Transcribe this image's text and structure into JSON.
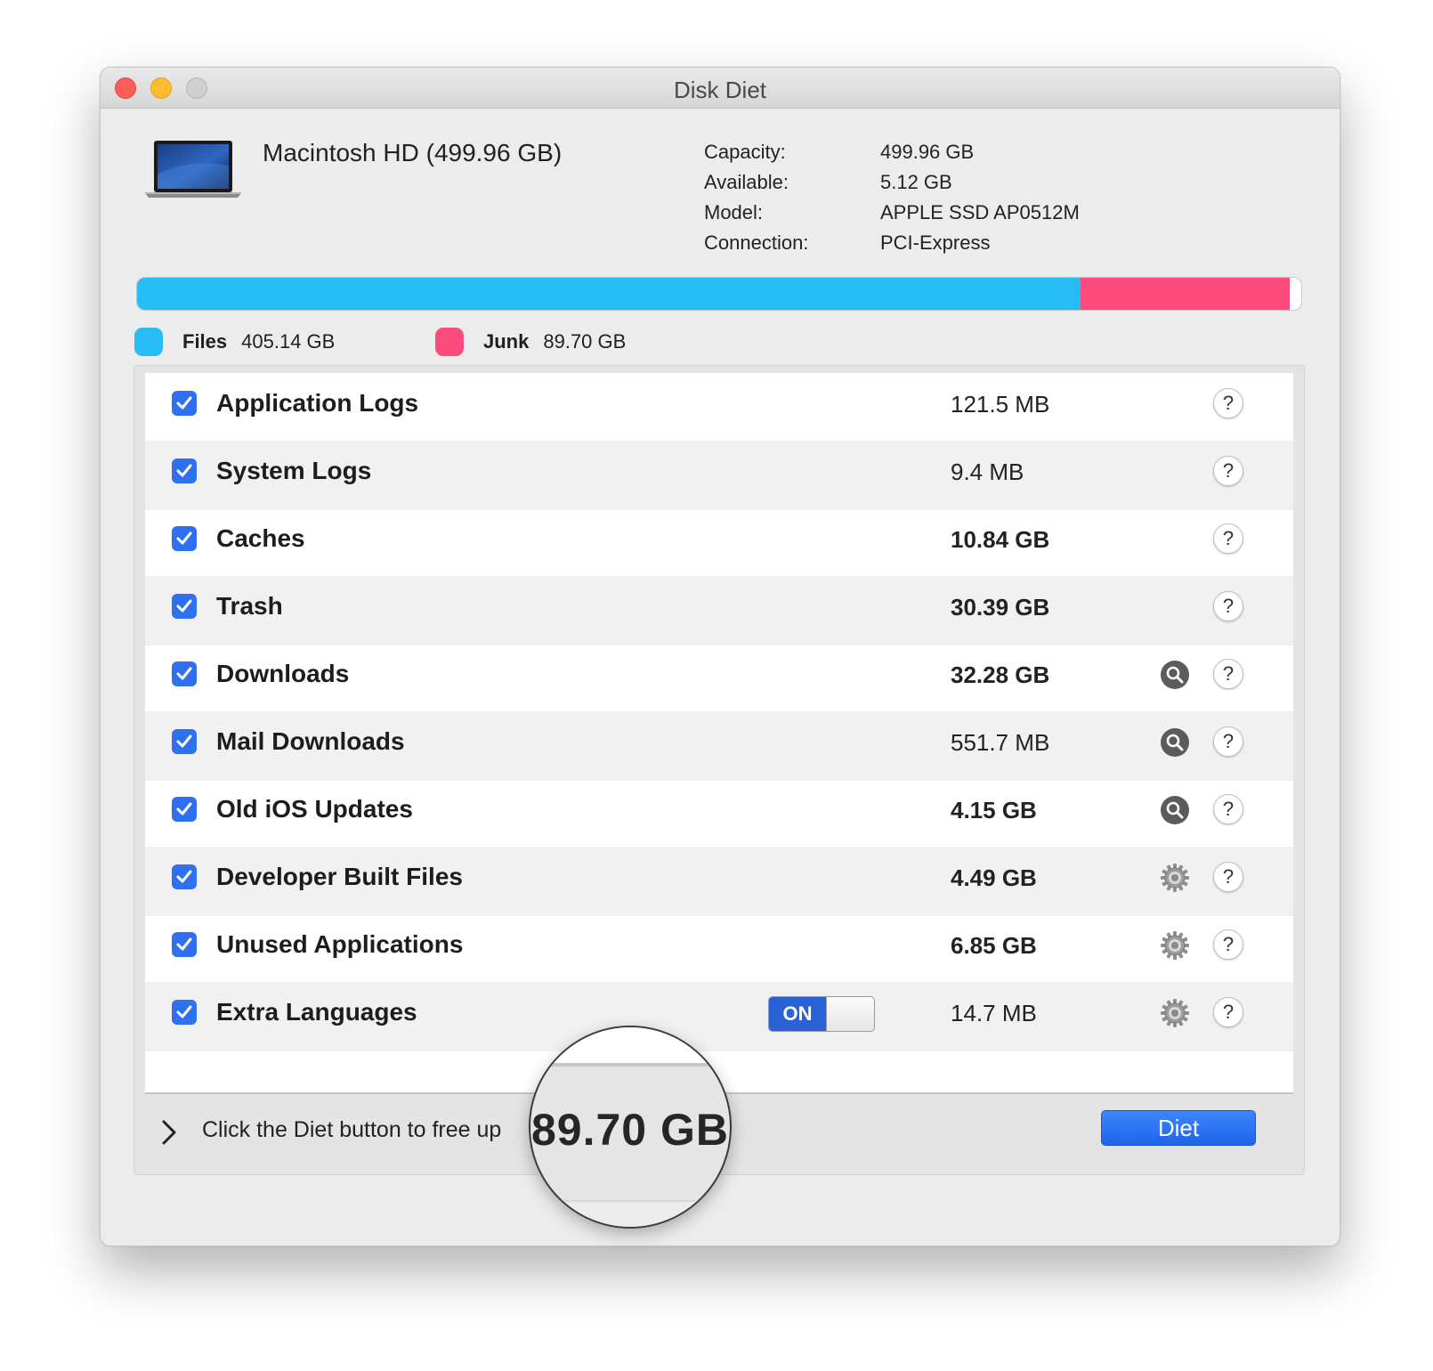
{
  "window": {
    "title": "Disk Diet"
  },
  "disk": {
    "name": "Macintosh HD (499.96 GB)",
    "info": [
      {
        "key": "Capacity:",
        "value": "499.96 GB"
      },
      {
        "key": "Available:",
        "value": "5.12 GB"
      },
      {
        "key": "Model:",
        "value": "APPLE SSD AP0512M"
      },
      {
        "key": "Connection:",
        "value": "PCI-Express"
      }
    ]
  },
  "usage": {
    "files_fraction": 0.8103,
    "junk_fraction": 0.1794,
    "files_color": "#27bcf4",
    "junk_color": "#fd4a7c"
  },
  "legend": {
    "files_label": "Files",
    "files_value": "405.14 GB",
    "junk_label": "Junk",
    "junk_value": "89.70 GB"
  },
  "items": [
    {
      "label": "Application Logs",
      "size": "121.5 MB",
      "size_bold": false,
      "checked": true,
      "action_icon": ""
    },
    {
      "label": "System Logs",
      "size": "9.4 MB",
      "size_bold": false,
      "checked": true,
      "action_icon": ""
    },
    {
      "label": "Caches",
      "size": "10.84 GB",
      "size_bold": true,
      "checked": true,
      "action_icon": ""
    },
    {
      "label": "Trash",
      "size": "30.39 GB",
      "size_bold": true,
      "checked": true,
      "action_icon": ""
    },
    {
      "label": "Downloads",
      "size": "32.28 GB",
      "size_bold": true,
      "checked": true,
      "action_icon": "magnifier-icon"
    },
    {
      "label": "Mail Downloads",
      "size": "551.7 MB",
      "size_bold": false,
      "checked": true,
      "action_icon": "magnifier-icon"
    },
    {
      "label": "Old iOS Updates",
      "size": "4.15 GB",
      "size_bold": true,
      "checked": true,
      "action_icon": "magnifier-icon"
    },
    {
      "label": "Developer Built Files",
      "size": "4.49 GB",
      "size_bold": true,
      "checked": true,
      "action_icon": "gear-icon"
    },
    {
      "label": "Unused Applications",
      "size": "6.85 GB",
      "size_bold": true,
      "checked": true,
      "action_icon": "gear-icon"
    },
    {
      "label": "Extra Languages",
      "size": "14.7 MB",
      "size_bold": false,
      "checked": true,
      "action_icon": "gear-icon",
      "toggle": "ON"
    }
  ],
  "help_label": "?",
  "footer": {
    "text": "Click the Diet button to free up",
    "amount": "89.70 GB",
    "diet_button": "Diet"
  }
}
